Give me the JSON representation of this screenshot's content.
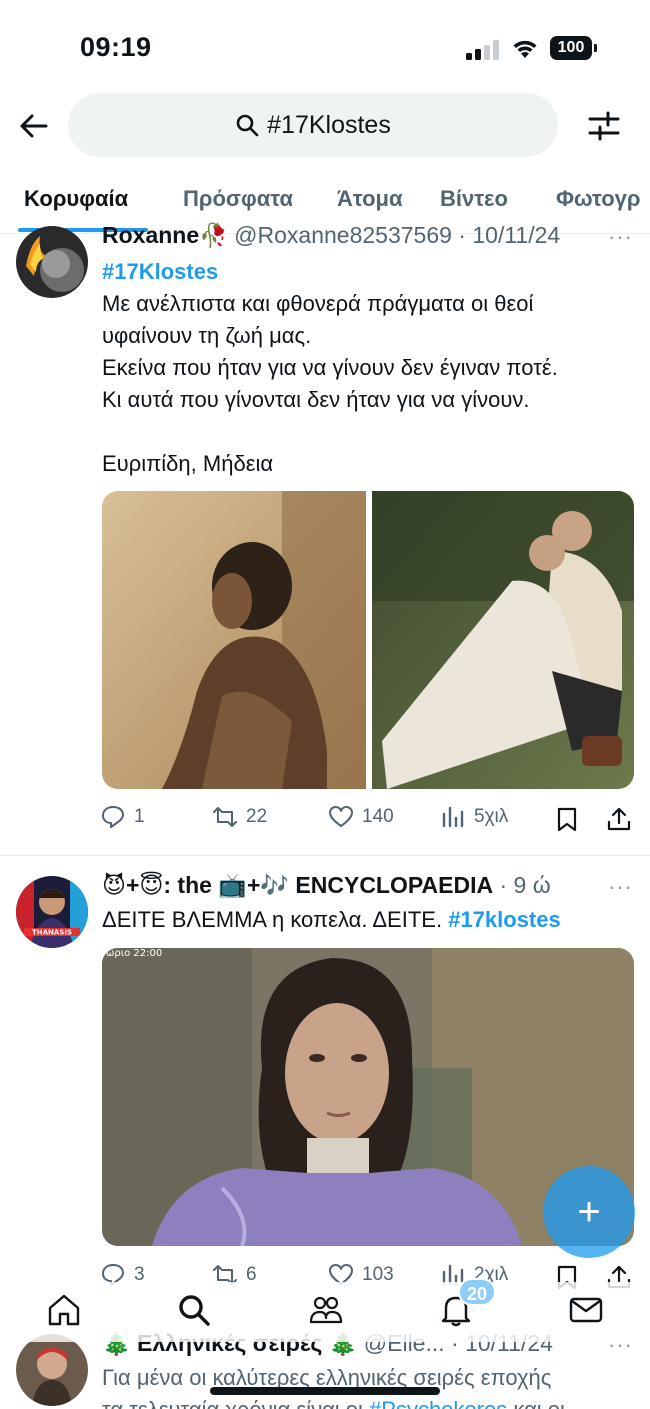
{
  "status_bar": {
    "time": "09:19",
    "battery": "100"
  },
  "search": {
    "query": "#17Klostes"
  },
  "tabs": [
    {
      "label": "Κορυφαία",
      "active": true
    },
    {
      "label": "Πρόσφατα",
      "active": false
    },
    {
      "label": "Άτομα",
      "active": false
    },
    {
      "label": "Βίντεο",
      "active": false
    },
    {
      "label": "Φωτογρ",
      "active": false
    }
  ],
  "tweets": [
    {
      "name": "Roxanne🥀",
      "handle_time": "@Roxanne82537569 · 10/11/24",
      "hashtag": "#17Klostes",
      "lines": [
        "Με ανέλπιστα και φθονερά πράγματα οι θεοί",
        "υφαίνουν τη ζωή μας.",
        "Εκείνα που ήταν για να γίνουν δεν έγιναν ποτέ.",
        "Κι αυτά που  γίνονται δεν ήταν για να γίνουν.",
        "",
        "Ευριπίδη, Μήδεια"
      ],
      "stats": {
        "replies": "1",
        "reposts": "22",
        "likes": "140",
        "views": "5χιλ"
      }
    },
    {
      "name": "😈+😇: the 📺+🎶 ENCYCLOPAEDIA",
      "time": "· 9 ώ",
      "text": "ΔΕΙΤΕ ΒΛΕΜΜΑ η κοπελα. ΔΕΙΤΕ.",
      "hashtag": "#17klostes",
      "avatar_text": "THANASIS",
      "media_overlay": "ωριο 22:00",
      "stats": {
        "replies": "3",
        "reposts": "6",
        "likes": "103",
        "views": "2χιλ"
      }
    },
    {
      "name": "🎄 Ελληνικές σειρές 🎄",
      "handle_time": "@Elle... · 10/11/24",
      "line1": "Για μένα οι καλύτερες ελληνικές σειρές εποχής",
      "line2_start": "τα τελευταία χρόνια είναι οι ",
      "line2_tag": "#Psychokoros",
      "line2_end": " και οι"
    }
  ],
  "nav": {
    "notifications_badge": "20"
  },
  "colors": {
    "accent": "#1d9bf0",
    "text": "#0f1419",
    "muted": "#536471"
  }
}
